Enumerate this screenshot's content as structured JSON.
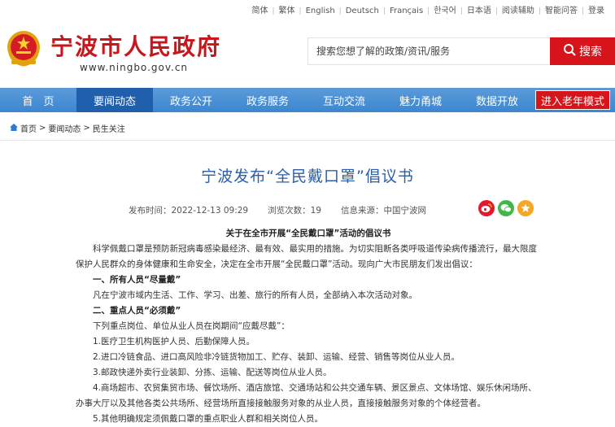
{
  "langbar": {
    "items": [
      "简体",
      "繁体",
      "English",
      "Deutsch",
      "Français",
      "한국어",
      "日本语",
      "阅读辅助",
      "智能问答",
      "登录"
    ]
  },
  "header": {
    "title": "宁波市人民政府",
    "url": "www.ningbo.gov.cn",
    "search_placeholder": "搜索您想了解的政策/资讯/服务",
    "search_button": "搜索"
  },
  "nav": {
    "items": [
      "首　页",
      "要闻动态",
      "政务公开",
      "政务服务",
      "互动交流",
      "魅力甬城",
      "数据开放"
    ],
    "active_index": 1,
    "elder_mode": "进入老年模式"
  },
  "breadcrumb": {
    "home": "首页",
    "sep1": ">",
    "level1": "要闻动态",
    "sep2": ">",
    "level2": "民生关注"
  },
  "article": {
    "title": "宁波发布“全民戴口罩”倡议书",
    "meta": {
      "publish_time": "发布时间：2022-12-13 09:29",
      "views": "浏览次数：19",
      "source": "信息来源：中国宁波网"
    },
    "heading": "关于在全市开展“全民戴口罩”活动的倡议书",
    "intro": "科学佩戴口罩是预防新冠病毒感染最经济、最有效、最实用的措施。为切实阻断各类呼吸道传染病传播流行，最大限度保护人民群众的身体健康和生命安全，决定在全市开展“全民戴口罩”活动。现向广大市民朋友们发出倡议：",
    "section1_title": "一、所有人员“尽量戴”",
    "section1_text": "凡在宁波市域内生活、工作、学习、出差、旅行的所有人员，全部纳入本次活动对象。",
    "section2_title": "二、重点人员“必须戴”",
    "section2_text": "下列重点岗位、单位从业人员在岗期间“应戴尽戴”：",
    "item1": "1.医疗卫生机构医护人员、后勤保障人员。",
    "item2": "2.进口冷链食品、进口高风险非冷链货物加工、贮存、装卸、运输、经营、销售等岗位从业人员。",
    "item3": "3.邮政快递外卖行业装卸、分拣、运输、配送等岗位从业人员。",
    "item4": "4.商场超市、农贸集贸市场、餐饮场所、酒店旅馆、交通场站和公共交通车辆、景区景点、文体场馆、娱乐休闲场所、办事大厅以及其他各类公共场所、经营场所直接接触服务对象的从业人员，直接接触服务对象的个体经营者。",
    "item5": "5.其他明确规定须佩戴口罩的重点职业人群和相关岗位人员。"
  },
  "colors": {
    "brand_red": "#c8161d",
    "nav_blue": "#3d86cf",
    "nav_active": "#1f5fab",
    "title_blue": "#2b5fa8"
  },
  "icons": [
    "national-emblem-icon",
    "search-icon",
    "home-icon",
    "weibo-icon",
    "wechat-icon",
    "favorite-icon"
  ]
}
